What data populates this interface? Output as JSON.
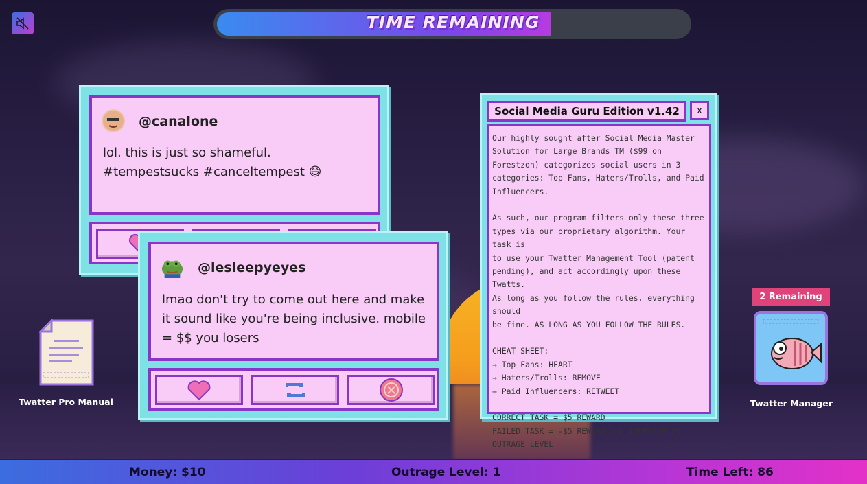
{
  "hud": {
    "timer_label": "TIME REMAINING",
    "timer_fraction": 0.71,
    "mute_icon": "speaker-muted-icon"
  },
  "twatts": [
    {
      "handle": "@canalone",
      "text_line1": "lol. this is just so shameful.",
      "text_line2": "#tempestsucks #canceltempest 😄",
      "avatar": "bald-man-avatar"
    },
    {
      "handle": "@lesleepyeyes",
      "text_line1": "lmao don't try to come out here and make",
      "text_line2": "it sound like you're being inclusive. mobile",
      "text_line3": "= $$ you losers",
      "avatar": "frog-avatar"
    }
  ],
  "actions": {
    "heart_icon": "heart-icon",
    "retweet_icon": "retweet-icon",
    "remove_icon": "remove-icon"
  },
  "guru_window": {
    "title": "Social Media Guru Edition v1.42",
    "close_label": "x",
    "p1": [
      "Our highly sought after Social Media Master",
      "Solution for Large Brands TM ($99 on",
      "Forestzon) categorizes social users in 3",
      "categories: Top Fans, Haters/Trolls, and Paid",
      "Influencers."
    ],
    "p2": [
      "As such, our program filters only these three",
      "types via our proprietary algorithm. Your task is",
      "to use your Twatter Management Tool (patent",
      "pending), and act accordingly upon these Twatts.",
      "As long as you follow the rules, everything should",
      "be fine. AS LONG AS YOU FOLLOW THE RULES."
    ],
    "p3": [
      "CHEAT SHEET:",
      "→ Top Fans: HEART",
      "→ Haters/Trolls: REMOVE",
      "→ Paid Influencers: RETWEET"
    ],
    "p4": [
      "CORRECT TASK = $5 REWARD",
      "FAILED TASK = -$5 REWARD and INCREASE IN",
      "OUTRAGE LEVEL"
    ]
  },
  "desktop": {
    "manual_label": "Twatter Pro Manual",
    "manager_label": "Twatter Manager",
    "remaining_badge": "2 Remaining"
  },
  "status": {
    "money": "Money: $10",
    "outrage": "Outrage Level: 1",
    "time_left": "Time Left: 86"
  },
  "colors": {
    "card_border": "#7de1e6",
    "card_fill": "#f8ccf6",
    "card_outline": "#8a35c8",
    "badge": "#e0427a"
  }
}
